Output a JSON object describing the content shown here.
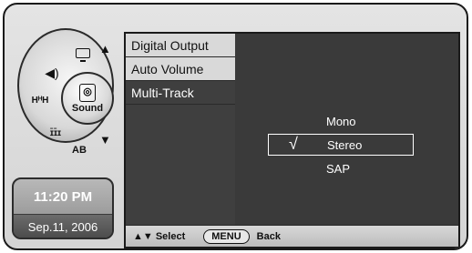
{
  "clock": {
    "time": "11:20 PM",
    "date": "Sep.11, 2006"
  },
  "wheel": {
    "center_label": "Sound",
    "ab_label": "AB",
    "hhh_label": "HᴴH",
    "tone_label": "ɪ̄ɪ̄ɪ",
    "up_arrow": "▲",
    "down_arrow": "▼"
  },
  "menu": {
    "items": [
      {
        "label": "Digital Output"
      },
      {
        "label": "Auto Volume"
      },
      {
        "label": "Multi-Track"
      }
    ]
  },
  "options": {
    "items": [
      {
        "label": "Mono"
      },
      {
        "label": "Stereo"
      },
      {
        "label": "SAP"
      }
    ],
    "selected_mark": "√"
  },
  "help": {
    "select_text": "▲▼ Select",
    "menu_key": "MENU",
    "back_text": "Back"
  },
  "colors": {
    "panel_bg": "#3a3a3a",
    "menu_item_bg": "#d9d9d9",
    "active_item_bg": "#3f3f3f",
    "clock_bg": "#8a8a8a"
  }
}
